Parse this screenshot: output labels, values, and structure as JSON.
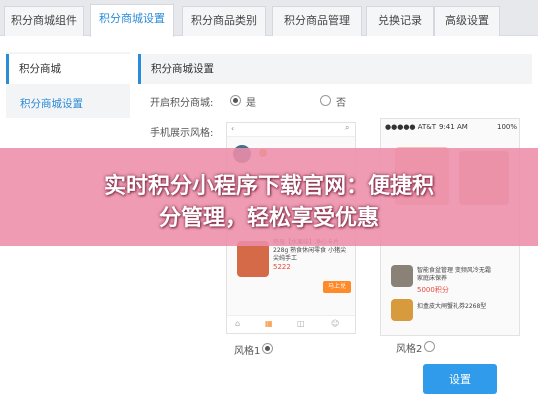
{
  "tabs": [
    "积分商城组件",
    "积分商城设置",
    "积分商品类别",
    "积分商品管理",
    "兑换记录",
    "高级设置"
  ],
  "sidebar": {
    "header": "积分商城",
    "item": "积分商城设置"
  },
  "main": {
    "title": "积分商城设置",
    "open_label": "开启积分商城:",
    "opt_yes": "是",
    "opt_no": "否",
    "style_label": "手机展示风格:",
    "style1": "风格1",
    "style2": "风格2"
  },
  "phone2": {
    "carrier": "●●●●● AT&T",
    "time": "9:41 AM",
    "battery": "100%",
    "item1": "智能食盆管理 变频风冷无霜",
    "item1b": "家庭床保养",
    "price1": "5000积分",
    "item2": "扣盒皮大闸蟹礼券2268型"
  },
  "phone1": {
    "product": "鸡母【水果味】净心卡片228g 熟食休闲零食 小猪尖尖纯手工",
    "price": "5222",
    "buy": "马上兑"
  },
  "banner": {
    "line1": "实时积分小程序下载官网：便捷积",
    "line2": "分管理，轻松享受优惠"
  },
  "button": "设置",
  "colors": {
    "accent": "#2a8bd8",
    "banner": "#ec8da8",
    "button": "#2f9bea"
  }
}
